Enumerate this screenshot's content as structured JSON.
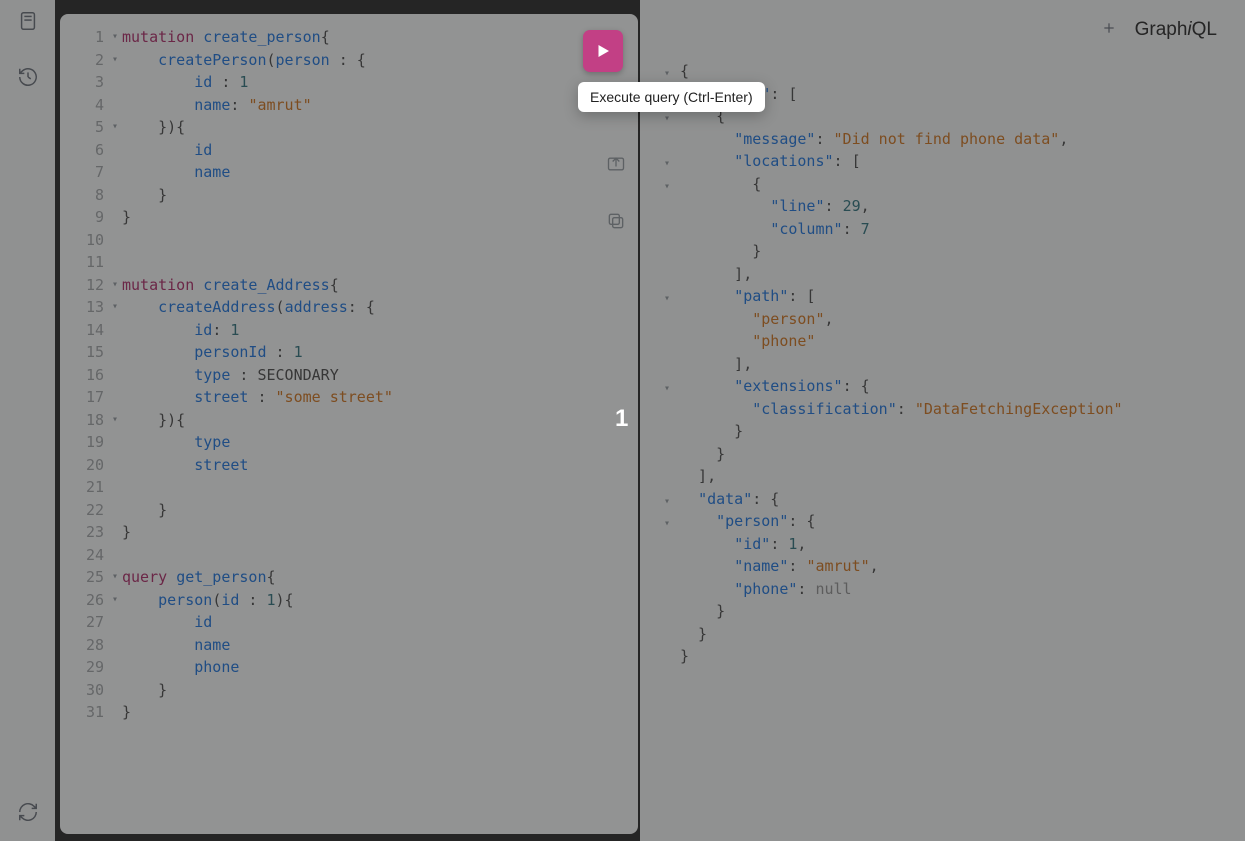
{
  "sidebar": {
    "docs_icon": "document-icon",
    "history_icon": "history-icon",
    "refresh_icon": "refresh-icon"
  },
  "toolbar": {
    "play_label": "▶",
    "tooltip": "Execute query (Ctrl-Enter)",
    "merge_icon": "merge-icon",
    "copy_icon": "copy-icon"
  },
  "header": {
    "add_icon": "plus-icon",
    "brand": "GraphiQL"
  },
  "center_badge": "1",
  "editor": {
    "line_numbers": [
      "1",
      "2",
      "3",
      "4",
      "5",
      "6",
      "7",
      "8",
      "9",
      "10",
      "11",
      "12",
      "13",
      "14",
      "15",
      "16",
      "17",
      "18",
      "19",
      "20",
      "21",
      "22",
      "23",
      "24",
      "25",
      "26",
      "27",
      "28",
      "29",
      "30",
      "31"
    ],
    "fold_rows": {
      "1": "▾",
      "2": "▾",
      "5": "▾",
      "12": "▾",
      "13": "▾",
      "18": "▾",
      "25": "▾",
      "26": "▾"
    },
    "lines": [
      {
        "t": [
          [
            "keyword",
            "mutation"
          ],
          [
            "punc",
            " "
          ],
          [
            "def",
            "create_person"
          ],
          [
            "punc",
            "{"
          ]
        ]
      },
      {
        "t": [
          [
            "punc",
            "    "
          ],
          [
            "def",
            "createPerson"
          ],
          [
            "punc",
            "("
          ],
          [
            "arg",
            "person"
          ],
          [
            "punc",
            " : {"
          ]
        ]
      },
      {
        "t": [
          [
            "punc",
            "        "
          ],
          [
            "attr",
            "id"
          ],
          [
            "punc",
            " : "
          ],
          [
            "num",
            "1"
          ]
        ]
      },
      {
        "t": [
          [
            "punc",
            "        "
          ],
          [
            "attr",
            "name"
          ],
          [
            "punc",
            ": "
          ],
          [
            "string",
            "\"amrut\""
          ]
        ]
      },
      {
        "t": [
          [
            "punc",
            "    }){"
          ]
        ]
      },
      {
        "t": [
          [
            "punc",
            "        "
          ],
          [
            "attr",
            "id"
          ]
        ]
      },
      {
        "t": [
          [
            "punc",
            "        "
          ],
          [
            "attr",
            "name"
          ]
        ]
      },
      {
        "t": [
          [
            "punc",
            "    }"
          ]
        ]
      },
      {
        "t": [
          [
            "punc",
            "}"
          ]
        ]
      },
      {
        "t": [
          [
            "punc",
            ""
          ]
        ]
      },
      {
        "t": [
          [
            "punc",
            ""
          ]
        ]
      },
      {
        "t": [
          [
            "keyword",
            "mutation"
          ],
          [
            "punc",
            " "
          ],
          [
            "def",
            "create_Address"
          ],
          [
            "punc",
            "{"
          ]
        ]
      },
      {
        "t": [
          [
            "punc",
            "    "
          ],
          [
            "def",
            "createAddress"
          ],
          [
            "punc",
            "("
          ],
          [
            "arg",
            "address"
          ],
          [
            "punc",
            ": {"
          ]
        ]
      },
      {
        "t": [
          [
            "punc",
            "        "
          ],
          [
            "attr",
            "id"
          ],
          [
            "punc",
            ": "
          ],
          [
            "num",
            "1"
          ]
        ]
      },
      {
        "t": [
          [
            "punc",
            "        "
          ],
          [
            "attr",
            "personId"
          ],
          [
            "punc",
            " : "
          ],
          [
            "num",
            "1"
          ]
        ]
      },
      {
        "t": [
          [
            "punc",
            "        "
          ],
          [
            "attr",
            "type"
          ],
          [
            "punc",
            " : "
          ],
          [
            "const",
            "SECONDARY"
          ]
        ]
      },
      {
        "t": [
          [
            "punc",
            "        "
          ],
          [
            "attr",
            "street"
          ],
          [
            "punc",
            " : "
          ],
          [
            "string",
            "\"some street\""
          ]
        ]
      },
      {
        "t": [
          [
            "punc",
            "    }){"
          ]
        ]
      },
      {
        "t": [
          [
            "punc",
            "        "
          ],
          [
            "attr",
            "type"
          ]
        ]
      },
      {
        "t": [
          [
            "punc",
            "        "
          ],
          [
            "attr",
            "street"
          ]
        ]
      },
      {
        "t": [
          [
            "punc",
            ""
          ]
        ]
      },
      {
        "t": [
          [
            "punc",
            "    }"
          ]
        ]
      },
      {
        "t": [
          [
            "punc",
            "}"
          ]
        ]
      },
      {
        "t": [
          [
            "punc",
            ""
          ]
        ]
      },
      {
        "t": [
          [
            "keyword",
            "query"
          ],
          [
            "punc",
            " "
          ],
          [
            "def",
            "get_person"
          ],
          [
            "punc",
            "{"
          ]
        ]
      },
      {
        "t": [
          [
            "punc",
            "    "
          ],
          [
            "def",
            "person"
          ],
          [
            "punc",
            "("
          ],
          [
            "arg",
            "id"
          ],
          [
            "punc",
            " : "
          ],
          [
            "num",
            "1"
          ],
          [
            "punc",
            "){"
          ]
        ]
      },
      {
        "t": [
          [
            "punc",
            "        "
          ],
          [
            "attr",
            "id"
          ]
        ]
      },
      {
        "t": [
          [
            "punc",
            "        "
          ],
          [
            "attr",
            "name"
          ]
        ]
      },
      {
        "t": [
          [
            "punc",
            "        "
          ],
          [
            "attr",
            "phone"
          ]
        ]
      },
      {
        "t": [
          [
            "punc",
            "    }"
          ]
        ]
      },
      {
        "t": [
          [
            "punc",
            "}"
          ]
        ]
      }
    ]
  },
  "result": {
    "lines": [
      {
        "fold": "▾",
        "t": [
          [
            "jpunc",
            "{"
          ]
        ]
      },
      {
        "fold": "▾",
        "t": [
          [
            "jpunc",
            "  "
          ],
          [
            "jkey",
            "\"errors\""
          ],
          [
            "jpunc",
            ": ["
          ]
        ]
      },
      {
        "fold": "▾",
        "t": [
          [
            "jpunc",
            "    {"
          ]
        ]
      },
      {
        "fold": "",
        "t": [
          [
            "jpunc",
            "      "
          ],
          [
            "jkey",
            "\"message\""
          ],
          [
            "jpunc",
            ": "
          ],
          [
            "jstr",
            "\"Did not find phone data\""
          ],
          [
            "jpunc",
            ","
          ]
        ]
      },
      {
        "fold": "▾",
        "t": [
          [
            "jpunc",
            "      "
          ],
          [
            "jkey",
            "\"locations\""
          ],
          [
            "jpunc",
            ": ["
          ]
        ]
      },
      {
        "fold": "▾",
        "t": [
          [
            "jpunc",
            "        {"
          ]
        ]
      },
      {
        "fold": "",
        "t": [
          [
            "jpunc",
            "          "
          ],
          [
            "jkey",
            "\"line\""
          ],
          [
            "jpunc",
            ": "
          ],
          [
            "jnum",
            "29"
          ],
          [
            "jpunc",
            ","
          ]
        ]
      },
      {
        "fold": "",
        "t": [
          [
            "jpunc",
            "          "
          ],
          [
            "jkey",
            "\"column\""
          ],
          [
            "jpunc",
            ": "
          ],
          [
            "jnum",
            "7"
          ]
        ]
      },
      {
        "fold": "",
        "t": [
          [
            "jpunc",
            "        }"
          ]
        ]
      },
      {
        "fold": "",
        "t": [
          [
            "jpunc",
            "      ],"
          ]
        ]
      },
      {
        "fold": "▾",
        "t": [
          [
            "jpunc",
            "      "
          ],
          [
            "jkey",
            "\"path\""
          ],
          [
            "jpunc",
            ": ["
          ]
        ]
      },
      {
        "fold": "",
        "t": [
          [
            "jpunc",
            "        "
          ],
          [
            "jstr",
            "\"person\""
          ],
          [
            "jpunc",
            ","
          ]
        ]
      },
      {
        "fold": "",
        "t": [
          [
            "jpunc",
            "        "
          ],
          [
            "jstr",
            "\"phone\""
          ]
        ]
      },
      {
        "fold": "",
        "t": [
          [
            "jpunc",
            "      ],"
          ]
        ]
      },
      {
        "fold": "▾",
        "t": [
          [
            "jpunc",
            "      "
          ],
          [
            "jkey",
            "\"extensions\""
          ],
          [
            "jpunc",
            ": {"
          ]
        ]
      },
      {
        "fold": "",
        "t": [
          [
            "jpunc",
            "        "
          ],
          [
            "jkey",
            "\"classification\""
          ],
          [
            "jpunc",
            ": "
          ],
          [
            "jstr",
            "\"DataFetchingException\""
          ]
        ]
      },
      {
        "fold": "",
        "t": [
          [
            "jpunc",
            "      }"
          ]
        ]
      },
      {
        "fold": "",
        "t": [
          [
            "jpunc",
            "    }"
          ]
        ]
      },
      {
        "fold": "",
        "t": [
          [
            "jpunc",
            "  ],"
          ]
        ]
      },
      {
        "fold": "▾",
        "t": [
          [
            "jpunc",
            "  "
          ],
          [
            "jkey",
            "\"data\""
          ],
          [
            "jpunc",
            ": {"
          ]
        ]
      },
      {
        "fold": "▾",
        "t": [
          [
            "jpunc",
            "    "
          ],
          [
            "jkey",
            "\"person\""
          ],
          [
            "jpunc",
            ": {"
          ]
        ]
      },
      {
        "fold": "",
        "t": [
          [
            "jpunc",
            "      "
          ],
          [
            "jkey",
            "\"id\""
          ],
          [
            "jpunc",
            ": "
          ],
          [
            "jnum",
            "1"
          ],
          [
            "jpunc",
            ","
          ]
        ]
      },
      {
        "fold": "",
        "t": [
          [
            "jpunc",
            "      "
          ],
          [
            "jkey",
            "\"name\""
          ],
          [
            "jpunc",
            ": "
          ],
          [
            "jstr",
            "\"amrut\""
          ],
          [
            "jpunc",
            ","
          ]
        ]
      },
      {
        "fold": "",
        "t": [
          [
            "jpunc",
            "      "
          ],
          [
            "jkey",
            "\"phone\""
          ],
          [
            "jpunc",
            ": "
          ],
          [
            "jnull",
            "null"
          ]
        ]
      },
      {
        "fold": "",
        "t": [
          [
            "jpunc",
            "    }"
          ]
        ]
      },
      {
        "fold": "",
        "t": [
          [
            "jpunc",
            "  }"
          ]
        ]
      },
      {
        "fold": "",
        "t": [
          [
            "jpunc",
            "}"
          ]
        ]
      }
    ]
  }
}
